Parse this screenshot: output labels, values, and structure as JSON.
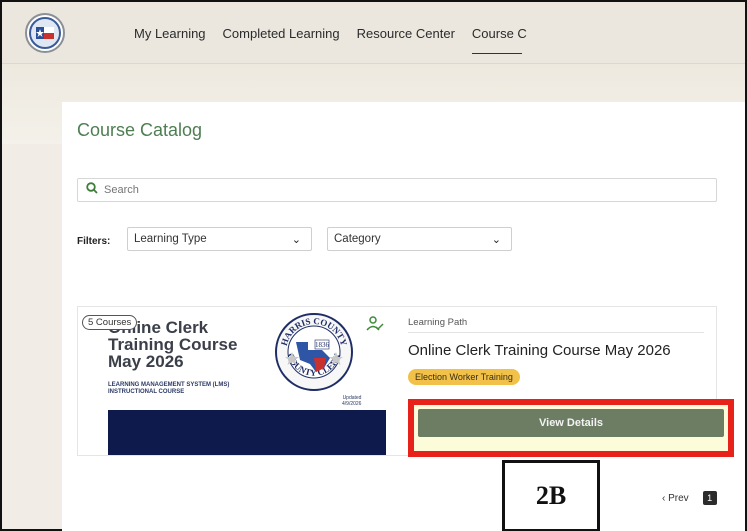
{
  "nav": {
    "items": [
      "My Learning",
      "Completed Learning",
      "Resource Center",
      "Course C"
    ],
    "active_index": 3
  },
  "page": {
    "title": "Course Catalog",
    "search_placeholder": "Search",
    "filters_label": "Filters:",
    "filter_type": "Learning Type",
    "filter_category": "Category"
  },
  "course": {
    "count_badge": "5 Courses",
    "thumb_title_line1": "Online Clerk",
    "thumb_title_line2": "Training Course",
    "thumb_title_line3": "May 2026",
    "thumb_sub_line1": "LEARNING MANAGEMENT SYSTEM (LMS)",
    "thumb_sub_line2": "INSTRUCTIONAL COURSE",
    "updated_label": "Updated",
    "updated_date": "4/9/2026",
    "seal_top": "HARRIS COUNTY",
    "seal_bottom": "COUNTY CLERK",
    "seal_year": "1836",
    "path_type": "Learning Path",
    "name": "Online Clerk Training Course May 2026",
    "tag": "Election Worker Training",
    "button": "View Details"
  },
  "annotation": {
    "label": "2B"
  },
  "pager": {
    "prev": "Prev",
    "current": "1"
  },
  "colors": {
    "accent_green": "#4e7e52",
    "button_green": "#6c7d63",
    "tag_yellow": "#f2c14a",
    "highlight_red": "#e8211b",
    "navy": "#0f1a4c"
  },
  "icons": [
    "county-logo-icon",
    "search-icon",
    "chevron-down-icon",
    "learning-path-icon",
    "chevron-left-icon"
  ]
}
